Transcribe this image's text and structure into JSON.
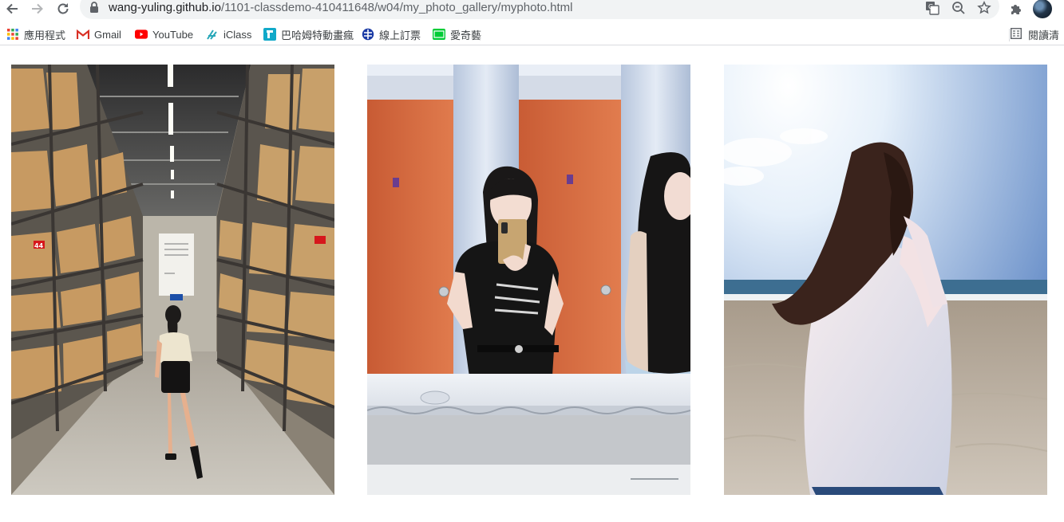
{
  "browser": {
    "url_host": "wang-yuling.github.io",
    "url_path": "/1101-classdemo-410411648/w04/my_photo_gallery/myphoto.html",
    "nav_icons": [
      "back-arrow-icon",
      "forward-arrow-icon",
      "reload-icon"
    ],
    "omnibox_icons": [
      "translate-icon",
      "zoom-icon",
      "bookmark-star-icon"
    ]
  },
  "bookmarks": {
    "items": [
      {
        "label": "應用程式",
        "icon": "apps-grid-icon"
      },
      {
        "label": "Gmail",
        "icon": "gmail-icon"
      },
      {
        "label": "YouTube",
        "icon": "youtube-icon"
      },
      {
        "label": "iClass",
        "icon": "iclass-icon"
      },
      {
        "label": "巴哈姆特動畫瘋",
        "icon": "bahamut-icon"
      },
      {
        "label": "線上訂票",
        "icon": "rail-ticket-icon"
      },
      {
        "label": "愛奇藝",
        "icon": "iqiyi-icon"
      }
    ],
    "reading_list": "閱讀清"
  },
  "gallery": {
    "photos": [
      {
        "scene": "warehouse aisle",
        "sign_number": "44"
      },
      {
        "scene": "mirror selfie"
      },
      {
        "scene": "beach"
      }
    ]
  }
}
